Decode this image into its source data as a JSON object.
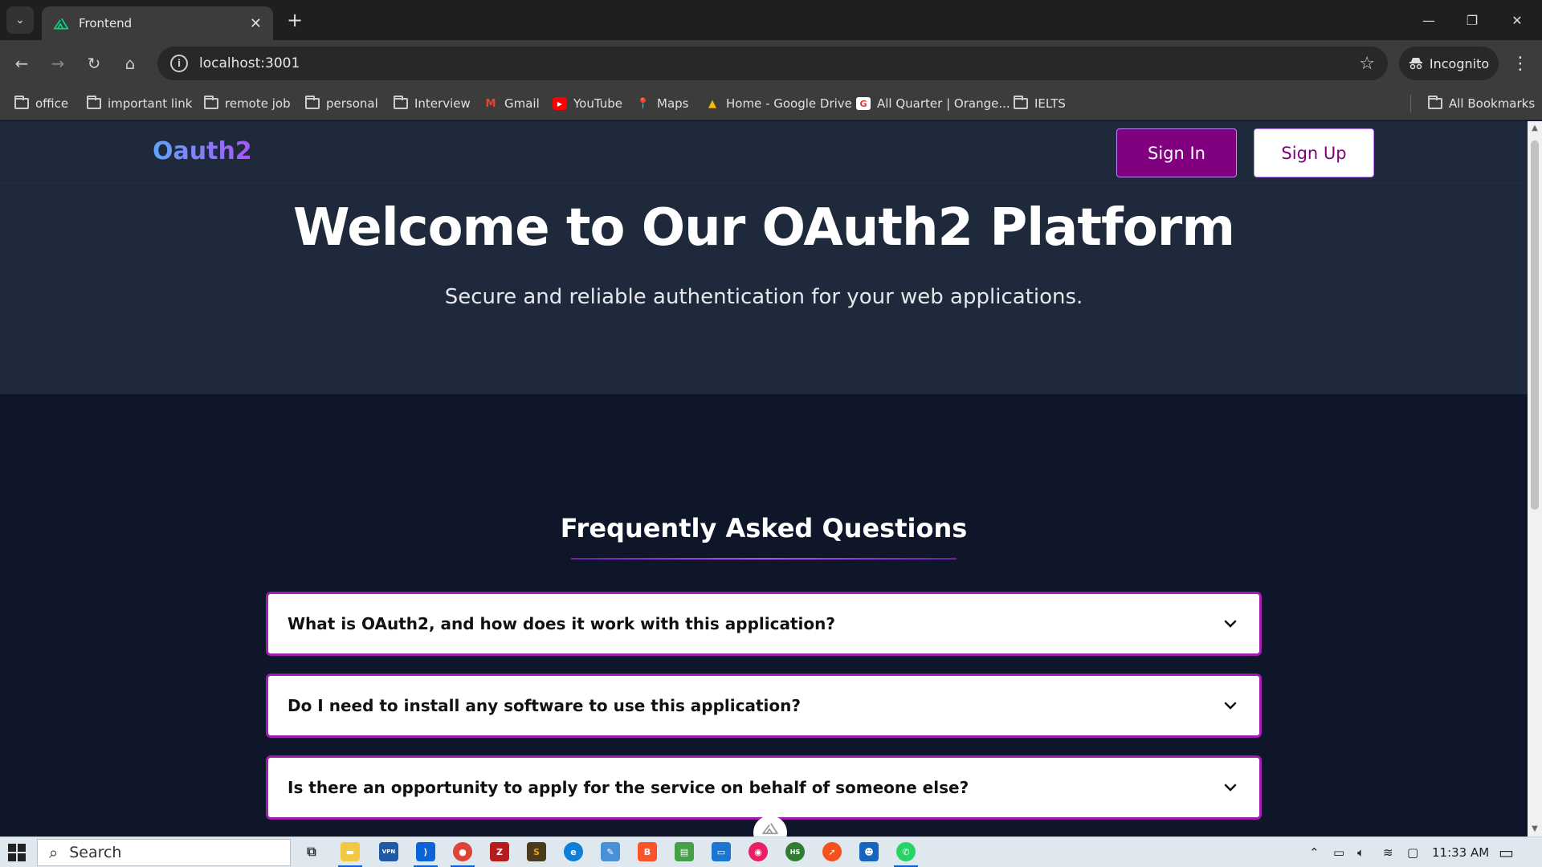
{
  "browser": {
    "tab_title": "Frontend",
    "url": "localhost:3001",
    "incognito_label": "Incognito",
    "bookmarks": [
      {
        "label": "office",
        "icon": "folder-icon"
      },
      {
        "label": "important link",
        "icon": "folder-icon"
      },
      {
        "label": "remote job",
        "icon": "folder-icon"
      },
      {
        "label": "personal",
        "icon": "folder-icon"
      },
      {
        "label": "Interview",
        "icon": "folder-icon"
      },
      {
        "label": "Gmail",
        "icon": "gmail-icon"
      },
      {
        "label": "YouTube",
        "icon": "youtube-icon"
      },
      {
        "label": "Maps",
        "icon": "maps-icon"
      },
      {
        "label": "Home - Google Drive",
        "icon": "drive-icon"
      },
      {
        "label": "All Quarter | Orange...",
        "icon": "site-icon"
      },
      {
        "label": "IELTS",
        "icon": "folder-icon"
      }
    ],
    "all_bookmarks_label": "All Bookmarks"
  },
  "navbar": {
    "logo": "Oauth2",
    "signin_label": "Sign In",
    "signup_label": "Sign Up"
  },
  "hero": {
    "title": "Welcome to Our OAuth2 Platform",
    "subtitle": "Secure and reliable authentication for your web applications."
  },
  "faq": {
    "title": "Frequently Asked Questions",
    "items": [
      {
        "question": "What is OAuth2, and how does it work with this application?"
      },
      {
        "question": "Do I need to install any software to use this application?"
      },
      {
        "question": "Is there an opportunity to apply for the service on behalf of someone else?"
      }
    ]
  },
  "taskbar": {
    "search_placeholder": "Search",
    "time": "11:33 AM"
  },
  "colors": {
    "brand_purple": "#800080",
    "hero_bg": "#1e293b",
    "page_bg": "#0f1629",
    "faq_border": "#a21caf"
  }
}
